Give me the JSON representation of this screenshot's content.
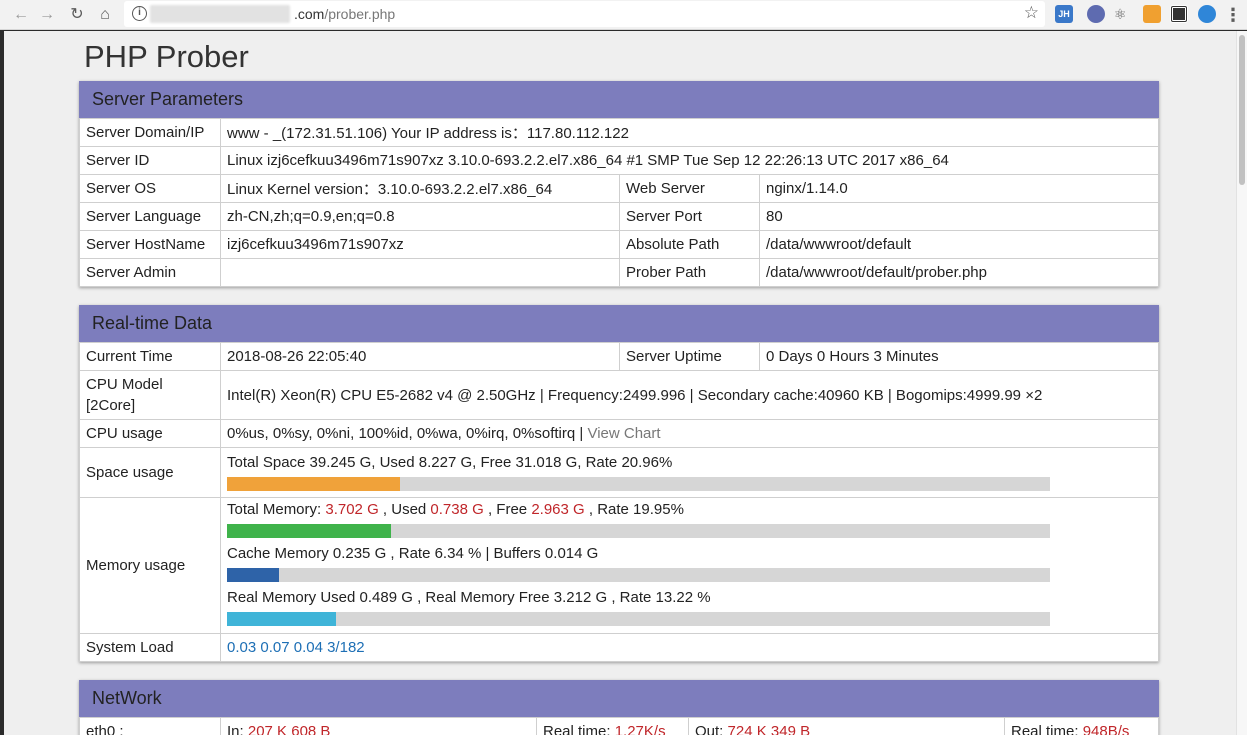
{
  "browser": {
    "url_host": ".com",
    "url_path": "/prober.php",
    "extensions": [
      "JH",
      "",
      "",
      "",
      "",
      ""
    ]
  },
  "page": {
    "title": "PHP Prober"
  },
  "server_params": {
    "header": "Server Parameters",
    "domain_label": "Server Domain/IP",
    "domain_value": "www - _(172.31.51.106)  Your IP address is：117.80.112.122",
    "id_label": "Server ID",
    "id_value": "Linux izj6cefkuu3496m71s907xz 3.10.0-693.2.2.el7.x86_64 #1 SMP Tue Sep 12 22:26:13 UTC 2017 x86_64",
    "os_label": "Server OS",
    "os_value": "Linux  Kernel version：3.10.0-693.2.2.el7.x86_64",
    "webserver_label": "Web Server",
    "webserver_value": "nginx/1.14.0",
    "language_label": "Server Language",
    "language_value": "zh-CN,zh;q=0.9,en;q=0.8",
    "port_label": "Server Port",
    "port_value": "80",
    "hostname_label": "Server HostName",
    "hostname_value": "izj6cefkuu3496m71s907xz",
    "abspath_label": "Absolute Path",
    "abspath_value": "/data/wwwroot/default",
    "admin_label": "Server Admin",
    "admin_value": "",
    "proberpath_label": "Prober Path",
    "proberpath_value": "/data/wwwroot/default/prober.php"
  },
  "realtime": {
    "header": "Real-time Data",
    "time_label": "Current Time",
    "time_value": "2018-08-26 22:05:40",
    "uptime_label": "Server Uptime",
    "uptime_value": "0 Days 0 Hours 3 Minutes",
    "cpu_model_label": "CPU Model [2Core]",
    "cpu_model_value": "Intel(R) Xeon(R) CPU E5-2682 v4 @ 2.50GHz | Frequency:2499.996 | Secondary cache:40960 KB | Bogomips:4999.99 ×2",
    "cpu_usage_label": "CPU usage",
    "cpu_usage_value": "0%us, 0%sy, 0%ni, 100%id, 0%wa, 0%irq, 0%softirq | ",
    "cpu_usage_link": "View Chart",
    "space_label": "Space usage",
    "space_text_prefix": "Total Space 39.245 G,   Used ",
    "space_used": "8.227",
    "space_mid": " G,   Free ",
    "space_free": "31.018",
    "space_suffix": " G,   Rate 20.96%",
    "space_rate": 0.2096,
    "memory_label": "Memory usage",
    "mem_total_prefix": "Total Memory: ",
    "mem_total": "3.702 G",
    "mem_used_prefix": " , Used ",
    "mem_used": "0.738 G",
    "mem_free_prefix": " , Free ",
    "mem_free": "2.963 G",
    "mem_rate_text": " , Rate 19.95%",
    "mem_rate": 0.1995,
    "cache_text": "Cache Memory 0.235 G , Rate 6.34 % | Buffers 0.014 G",
    "cache_rate": 0.0634,
    "real_text": "Real Memory Used 0.489 G , Real Memory Free 3.212 G , Rate 13.22 %",
    "real_rate": 0.1322,
    "load_label": "System Load",
    "load_value": "0.03 0.07 0.04 3/182"
  },
  "network": {
    "header": "NetWork",
    "iface_label": "eth0 :",
    "in_prefix": "In: ",
    "in_value": "207 K 608 B",
    "rt_in_prefix": "Real time: ",
    "rt_in_value": "1.27K/s",
    "out_prefix": "Out: ",
    "out_value": "724 K 349 B",
    "rt_out_prefix": "Real time: ",
    "rt_out_value": "948B/s"
  },
  "colors": {
    "header_bg": "#7d7dbd",
    "space_bar": "#f0a23a",
    "mem_bar": "#3fb34b",
    "cache_bar": "#2e63a8",
    "real_bar": "#3fb4d8",
    "accent_red": "#c0262a"
  }
}
